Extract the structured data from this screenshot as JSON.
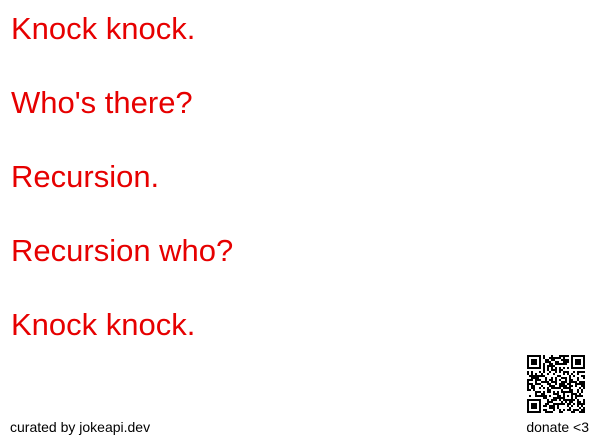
{
  "joke": {
    "lines": [
      "Knock knock.",
      "Who's there?",
      "Recursion.",
      "Recursion who?",
      "Knock knock."
    ]
  },
  "footer": {
    "credit": "curated by jokeapi.dev",
    "donate": "donate <3"
  },
  "colors": {
    "joke_text": "#e60000",
    "footer_text": "#000000",
    "background": "#ffffff"
  }
}
